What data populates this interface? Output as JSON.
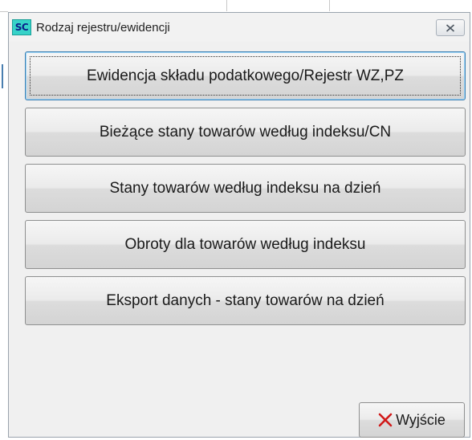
{
  "window": {
    "title": "Rodzaj rejestru/ewidencji",
    "app_icon_text": "SC",
    "close_icon": "close-icon"
  },
  "buttons": [
    {
      "label": "Ewidencja składu podatkowego/Rejestr WZ,PZ",
      "focused": true
    },
    {
      "label": "Bieżące stany towarów według indeksu/CN",
      "focused": false
    },
    {
      "label": "Stany towarów według indeksu na dzień",
      "focused": false
    },
    {
      "label": "Obroty dla towarów według indeksu",
      "focused": false
    },
    {
      "label": "Eksport danych - stany towarów na dzień",
      "focused": false
    }
  ],
  "exit_button": {
    "label": "Wyjście",
    "icon": "x-icon",
    "icon_color": "#d11a1a"
  },
  "colors": {
    "focus_border": "#3c7fb1",
    "app_icon_bg": "#36d2c8"
  }
}
